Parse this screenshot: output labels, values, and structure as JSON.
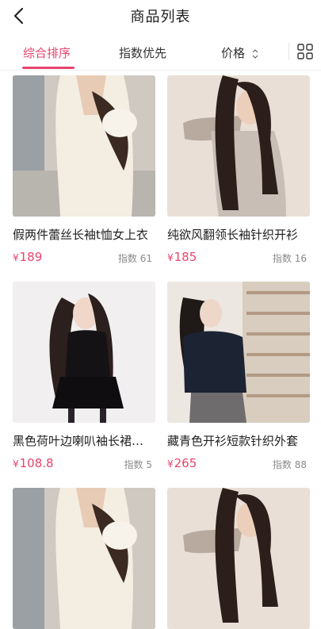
{
  "header": {
    "title": "商品列表"
  },
  "tabs": [
    {
      "label": "综合排序"
    },
    {
      "label": "指数优先"
    },
    {
      "label": "价格"
    }
  ],
  "products": [
    {
      "name": "假两件蕾丝长袖t恤女上衣",
      "currency": "¥",
      "price": "189",
      "index_label": "指数 61"
    },
    {
      "name": "纯欲风翻领长袖针织开衫",
      "currency": "¥",
      "price": "185",
      "index_label": "指数 16"
    },
    {
      "name": "黑色荷叶边喇叭袖长裙连衣裙",
      "currency": "¥",
      "price": "108.8",
      "index_label": "指数 5"
    },
    {
      "name": "藏青色开衫短款针织外套",
      "currency": "¥",
      "price": "265",
      "index_label": "指数 88"
    }
  ],
  "colors": {
    "accent": "#e8436e"
  },
  "icons": [
    "back-icon",
    "chevron-updown-icon",
    "grid-icon"
  ]
}
